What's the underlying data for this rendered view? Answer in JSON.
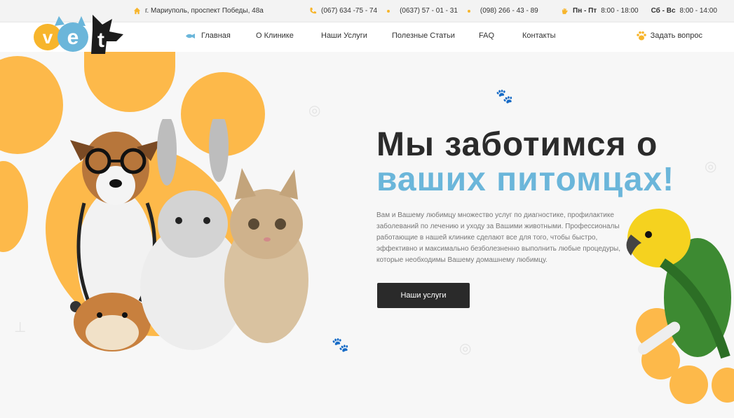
{
  "topbar": {
    "address": "г. Мариуполь, проспект Победы, 48а",
    "phones": [
      "(067) 634 -75 - 74",
      "(0637) 57 - 01 - 31",
      "(098) 266 - 43 - 89"
    ],
    "hours_weekdays_label": "Пн - Пт",
    "hours_weekdays": "8:00 - 18:00",
    "hours_weekend_label": "Сб - Вс",
    "hours_weekend": "8:00 - 14:00"
  },
  "logo": {
    "text": "vet"
  },
  "nav": {
    "items": [
      "Главная",
      "О Клинике",
      "Наши Услуги",
      "Полезные Статьи",
      "FAQ",
      "Контакты"
    ],
    "ask_label": "Задать вопрос"
  },
  "hero": {
    "title_line1": "Мы заботимся о",
    "title_line2": "ваших питомцах!",
    "description": "Вам и Вашему любимцу множество услуг по диагностике, профилактике заболеваний по лечению и уходу за Вашими животными. Профессионалы работающие в нашей клинике сделают все для того, чтобы быстро, эффективно и максимально безболезненно выполнить любые процедуры, которые необходимы Вашему домашнему любимцу.",
    "cta_label": "Наши услуги"
  },
  "colors": {
    "accent": "#fdb94a",
    "blue": "#6bb6da",
    "dark": "#2a2a2a"
  }
}
